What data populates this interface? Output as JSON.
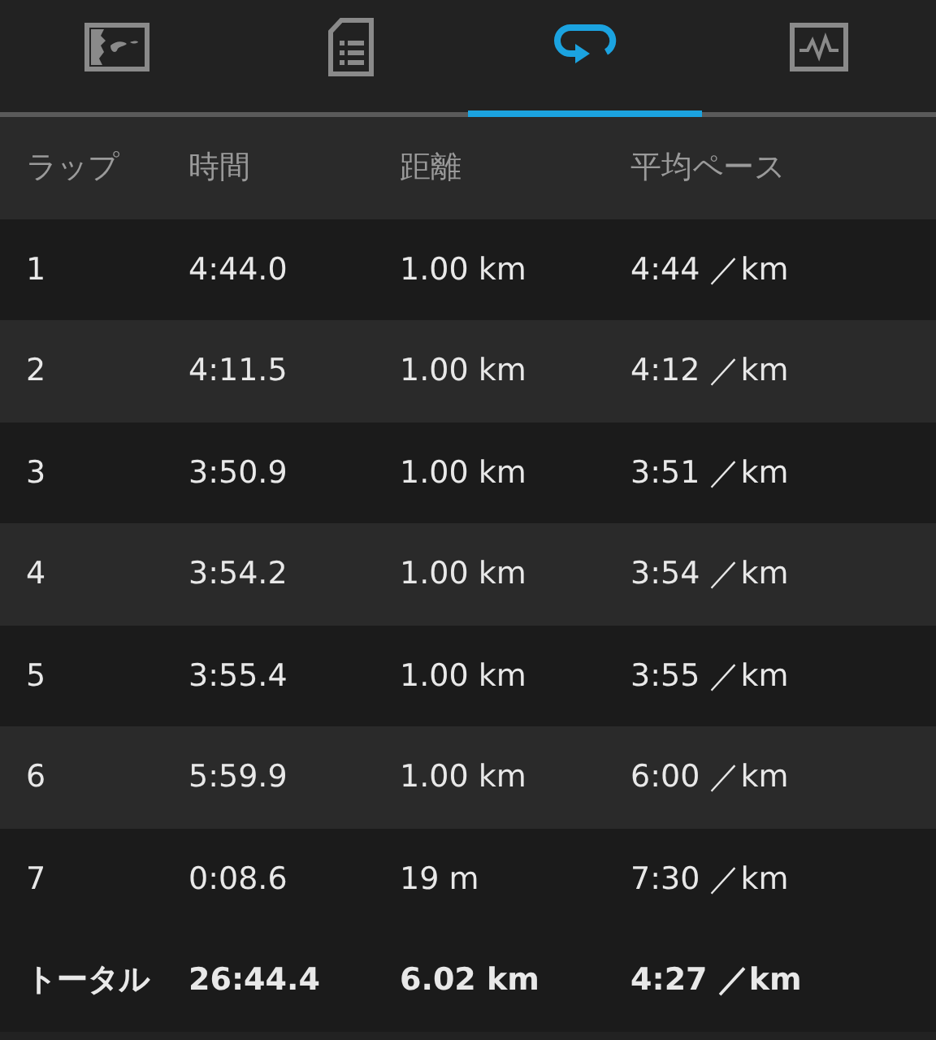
{
  "tabs": [
    {
      "kind": "map",
      "selected": false
    },
    {
      "kind": "document",
      "selected": false
    },
    {
      "kind": "laps",
      "selected": true
    },
    {
      "kind": "chart",
      "selected": false
    }
  ],
  "table": {
    "columns": [
      "ラップ",
      "時間",
      "距離",
      "平均ペース"
    ],
    "rows": [
      [
        "1",
        "4:44.0",
        "1.00 km",
        "4:44 ／km"
      ],
      [
        "2",
        "4:11.5",
        "1.00 km",
        "4:12 ／km"
      ],
      [
        "3",
        "3:50.9",
        "1.00 km",
        "3:51 ／km"
      ],
      [
        "4",
        "3:54.2",
        "1.00 km",
        "3:54 ／km"
      ],
      [
        "5",
        "3:55.4",
        "1.00 km",
        "3:55 ／km"
      ],
      [
        "6",
        "5:59.9",
        "1.00 km",
        "6:00 ／km"
      ],
      [
        "7",
        "0:08.6",
        "19 m",
        "7:30 ／km"
      ]
    ],
    "total": [
      "トータル",
      "26:44.4",
      "6.02 km",
      "4:27 ／km"
    ]
  }
}
